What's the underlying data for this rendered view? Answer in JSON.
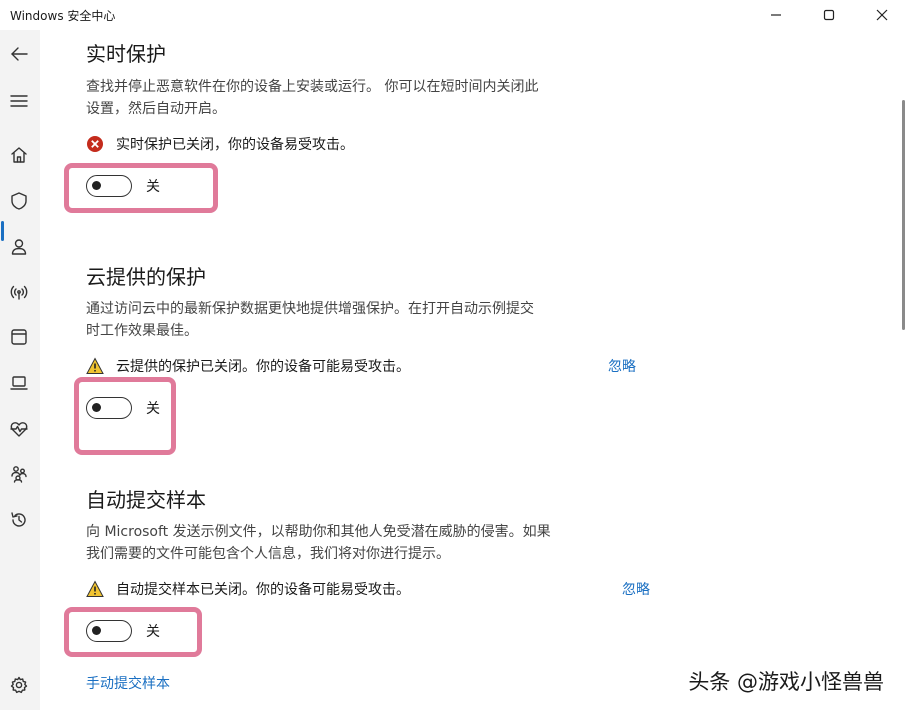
{
  "window": {
    "title": "Windows 安全中心",
    "minimize_icon": "minimize-icon",
    "maximize_icon": "maximize-icon",
    "close_icon": "close-icon"
  },
  "sidebar": {
    "items": [
      {
        "icon": "back-arrow-icon"
      },
      {
        "icon": "hamburger-menu-icon"
      },
      {
        "icon": "home-icon"
      },
      {
        "icon": "shield-icon",
        "active": true
      },
      {
        "icon": "account-icon"
      },
      {
        "icon": "wireless-icon"
      },
      {
        "icon": "app-browser-icon"
      },
      {
        "icon": "laptop-icon"
      },
      {
        "icon": "heart-pulse-icon"
      },
      {
        "icon": "family-icon"
      },
      {
        "icon": "history-icon"
      },
      {
        "icon": "settings-icon"
      }
    ],
    "accent_color": "#1a6fc2"
  },
  "sections": {
    "realtime": {
      "title": "实时保护",
      "desc_line1": "查找并停止恶意软件在你的设备上安装或运行。 你可以在短时间内关闭此",
      "desc_line2": "设置，然后自动开启。",
      "status": "实时保护已关闭，你的设备易受攻击。",
      "status_icon": "error-icon",
      "toggle_label": "关"
    },
    "cloud": {
      "title": "云提供的保护",
      "desc_line1": "通过访问云中的最新保护数据更快地提供增强保护。在打开自动示例提交",
      "desc_line2": "时工作效果最佳。",
      "status": "云提供的保护已关闭。你的设备可能易受攻击。",
      "status_icon": "warning-icon",
      "ignore": "忽略",
      "toggle_label": "关"
    },
    "sample": {
      "title": "自动提交样本",
      "desc_line1": "向 Microsoft 发送示例文件，以帮助你和其他人免受潜在威胁的侵害。如果",
      "desc_line2": "我们需要的文件可能包含个人信息，我们将对你进行提示。",
      "status": "自动提交样本已关闭。你的设备可能易受攻击。",
      "status_icon": "warning-icon",
      "ignore": "忽略",
      "toggle_label": "关",
      "manual_link": "手动提交样本"
    }
  },
  "colors": {
    "highlight": "#e07a9a",
    "error": "#c42b1c",
    "warning": "#f0c330",
    "link": "#1a6fc2"
  },
  "watermark": "头条 @游戏小怪兽兽"
}
